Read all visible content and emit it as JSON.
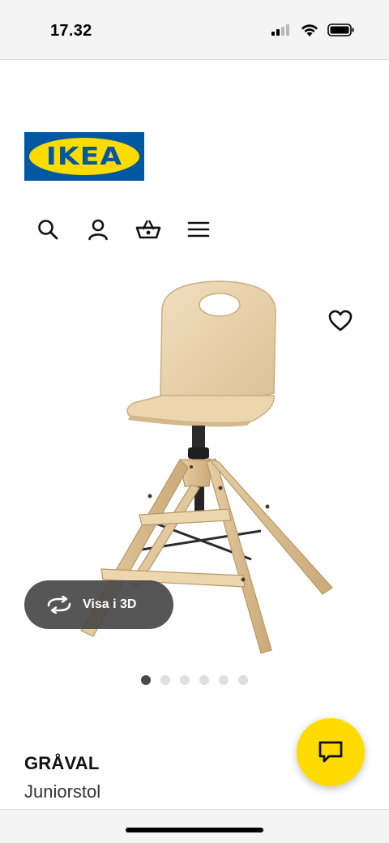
{
  "status_bar": {
    "time": "17.32"
  },
  "header": {
    "logo_text": "IKEA",
    "nav_icons": [
      "search-icon",
      "user-icon",
      "basket-icon",
      "menu-icon"
    ]
  },
  "product": {
    "name": "GRÅVAL",
    "type": "Juniorstol",
    "view3d_label": "Visa i 3D",
    "image_count": 6,
    "active_image": 1
  },
  "colors": {
    "ikea_blue": "#0058a3",
    "ikea_yellow": "#ffdb00",
    "overlay_gray": "#484848",
    "dot_inactive": "#dfdfdf"
  }
}
